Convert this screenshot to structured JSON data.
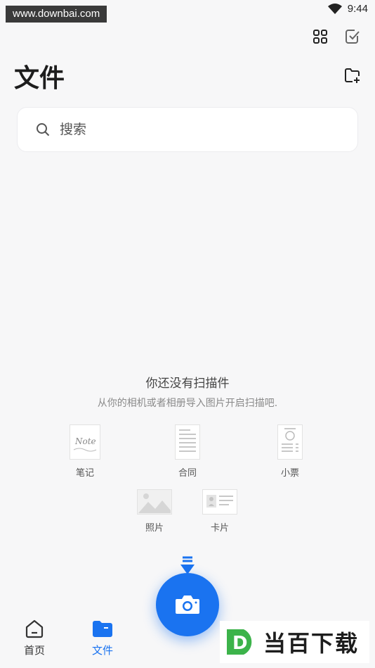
{
  "status_bar": {
    "watermark": "www.downbai.com",
    "time": "9:44"
  },
  "header": {
    "title": "文件"
  },
  "search": {
    "placeholder": "搜索"
  },
  "empty_state": {
    "title": "你还没有扫描件",
    "subtitle": "从你的相机或者相册导入图片开启扫描吧."
  },
  "templates": [
    {
      "label": "笔记",
      "icon": "note-thumbnail"
    },
    {
      "label": "合同",
      "icon": "contract-thumbnail"
    },
    {
      "label": "小票",
      "icon": "receipt-thumbnail"
    },
    {
      "label": "照片",
      "icon": "photo-thumbnail"
    },
    {
      "label": "卡片",
      "icon": "card-thumbnail"
    }
  ],
  "note_thumb_text": "Note",
  "bottom_nav": {
    "items": [
      {
        "label": "首页",
        "icon": "home-icon",
        "active": false
      },
      {
        "label": "文件",
        "icon": "folder-icon",
        "active": true
      }
    ]
  },
  "logo": {
    "text": "当百下载",
    "letter": "D"
  },
  "colors": {
    "accent": "#1a73f0",
    "background": "#f7f7f8",
    "logo_green": "#3cb34a"
  }
}
